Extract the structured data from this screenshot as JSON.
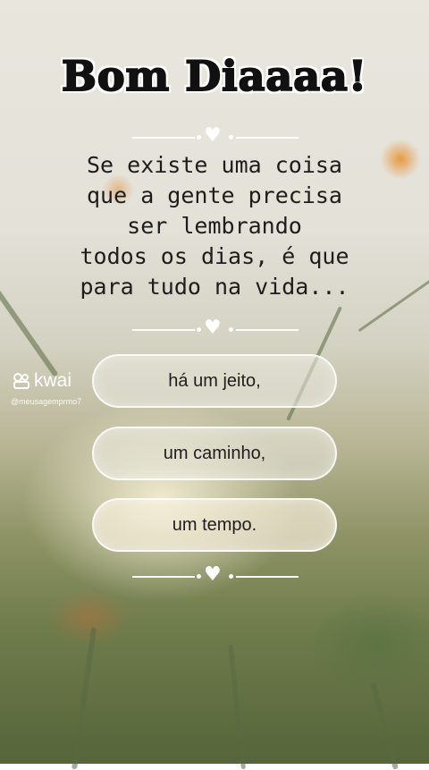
{
  "title": "Bom Diaaaa!",
  "message_lines": [
    "Se existe uma coisa",
    "que a gente precisa",
    "ser lembrando",
    "todos os dias, é que",
    "para tudo na vida..."
  ],
  "options": [
    {
      "label": "há um jeito,"
    },
    {
      "label": "um caminho,"
    },
    {
      "label": "um tempo."
    }
  ],
  "watermark": {
    "brand": "kwai",
    "handle": "@meusagemprmo7"
  },
  "colors": {
    "title_fill": "#111111",
    "title_outline": "#ffffff",
    "text": "#1d1d1d",
    "divider": "#ffffff"
  },
  "icons": {
    "divider": "heart-icon",
    "watermark": "kwai-logo-icon"
  }
}
